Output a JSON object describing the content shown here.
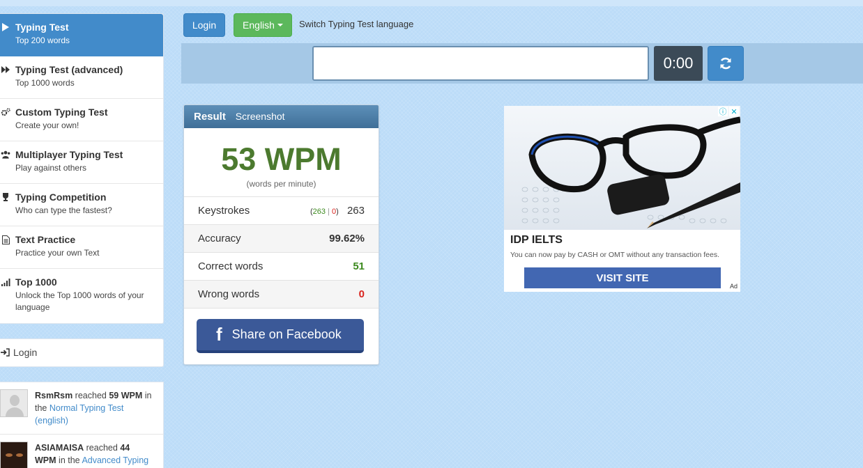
{
  "sidebar": {
    "items": [
      {
        "title": "Typing Test",
        "subtitle": "Top 200 words",
        "icon": "play-icon"
      },
      {
        "title": "Typing Test (advanced)",
        "subtitle": "Top 1000 words",
        "icon": "fast-forward-icon"
      },
      {
        "title": "Custom Typing Test",
        "subtitle": "Create your own!",
        "icon": "gears-icon"
      },
      {
        "title": "Multiplayer Typing Test",
        "subtitle": "Play against others",
        "icon": "users-icon"
      },
      {
        "title": "Typing Competition",
        "subtitle": "Who can type the fastest?",
        "icon": "trophy-icon"
      },
      {
        "title": "Text Practice",
        "subtitle": "Practice your own Text",
        "icon": "document-icon"
      },
      {
        "title": "Top 1000",
        "subtitle": "Unlock the Top 1000 words of your language",
        "icon": "signal-bars-icon"
      }
    ],
    "login_label": "Login",
    "feed": [
      {
        "user": "RsmRsm",
        "reached": "reached",
        "wpm": "59 WPM",
        "in": "in the",
        "link": "Normal Typing Test (english)"
      },
      {
        "user": "ASIAMAISA",
        "reached": "reached",
        "wpm": "44 WPM",
        "in": "in the",
        "link": "Advanced Typing"
      }
    ]
  },
  "topbar": {
    "login_label": "Login",
    "language_label": "English",
    "switch_text": "Switch Typing Test language"
  },
  "typing": {
    "input_value": "",
    "timer": "0:00"
  },
  "result": {
    "title": "Result",
    "screenshot_label": "Screenshot",
    "wpm": "53 WPM",
    "wpm_sub": "(words per minute)",
    "keystrokes_label": "Keystrokes",
    "keystrokes_correct": "263",
    "keystrokes_sep": "|",
    "keystrokes_wrong": "0",
    "keystrokes_total": "263",
    "accuracy_label": "Accuracy",
    "accuracy_value": "99.62%",
    "correct_label": "Correct words",
    "correct_value": "51",
    "wrong_label": "Wrong words",
    "wrong_value": "0",
    "share_label": "Share on Facebook"
  },
  "ad": {
    "title": "IDP IELTS",
    "description": "You can now pay by CASH or OMT without any transaction fees.",
    "button": "VISIT SITE",
    "tag": "Ad"
  },
  "colors": {
    "primary": "#428bca",
    "success": "#5cb85c",
    "wpm_green": "#4c7a2f",
    "danger": "#d9231d",
    "facebook": "#3b5998"
  }
}
